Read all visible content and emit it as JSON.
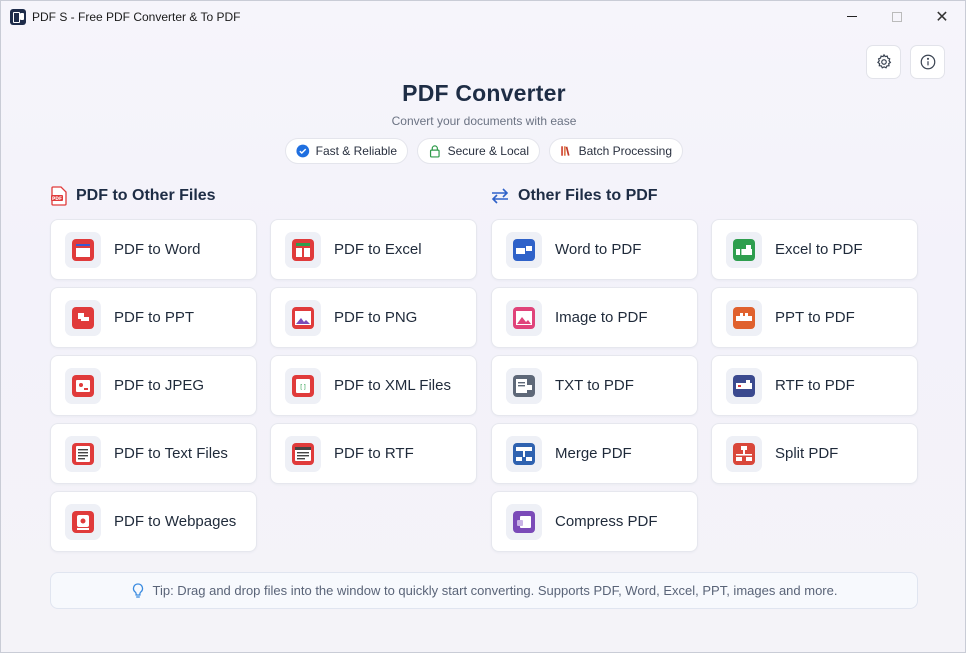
{
  "window": {
    "title": "PDF S - Free PDF Converter & To PDF",
    "minimize": "–",
    "maximize": "□",
    "close": "✕"
  },
  "header": {
    "title": "PDF Converter",
    "subtitle": "Convert your documents with ease",
    "badges": [
      {
        "label": "Fast & Reliable",
        "icon": "check-circle-icon",
        "color": "#1f6fe0"
      },
      {
        "label": "Secure & Local",
        "icon": "lock-icon",
        "color": "#2f9a4a"
      },
      {
        "label": "Batch Processing",
        "icon": "stack-icon",
        "color": "#d04a3a"
      }
    ]
  },
  "toolbar": {
    "settings_icon": "gear-icon",
    "info_icon": "info-icon"
  },
  "sections": {
    "pdf_to_other": {
      "title": "PDF to Other Files",
      "icon": "pdf-file-icon",
      "items": [
        {
          "label": "PDF to Word",
          "icon": "word-doc-icon",
          "color": "#e03b3b"
        },
        {
          "label": "PDF to Excel",
          "icon": "excel-sheet-icon",
          "color": "#e03b3b"
        },
        {
          "label": "PDF to PPT",
          "icon": "slides-icon",
          "color": "#e03b3b"
        },
        {
          "label": "PDF to PNG",
          "icon": "image-icon",
          "color": "#e03b3b"
        },
        {
          "label": "PDF to JPEG",
          "icon": "photo-icon",
          "color": "#e03b3b"
        },
        {
          "label": "PDF to XML Files",
          "icon": "xml-file-icon",
          "color": "#e03b3b"
        },
        {
          "label": "PDF to Text Files",
          "icon": "text-file-icon",
          "color": "#e03b3b"
        },
        {
          "label": "PDF to RTF",
          "icon": "rtf-file-icon",
          "color": "#e03b3b"
        },
        {
          "label": "PDF to Webpages",
          "icon": "webpage-icon",
          "color": "#e03b3b"
        }
      ]
    },
    "other_to_pdf": {
      "title": "Other Files to PDF",
      "icon": "swap-arrows-icon",
      "items": [
        {
          "label": "Word to PDF",
          "icon": "word-to-pdf-icon",
          "color": "#2f62c9"
        },
        {
          "label": "Excel to PDF",
          "icon": "excel-to-pdf-icon",
          "color": "#2e9e4e"
        },
        {
          "label": "Image to PDF",
          "icon": "image-to-pdf-icon",
          "color": "#e0437a"
        },
        {
          "label": "PPT to PDF",
          "icon": "ppt-to-pdf-icon",
          "color": "#e0612e"
        },
        {
          "label": "TXT to PDF",
          "icon": "txt-to-pdf-icon",
          "color": "#5e6878"
        },
        {
          "label": "RTF to PDF",
          "icon": "rtf-to-pdf-icon",
          "color": "#3b4a8f"
        },
        {
          "label": "Merge PDF",
          "icon": "merge-icon",
          "color": "#2f62b0"
        },
        {
          "label": "Split PDF",
          "icon": "split-icon",
          "color": "#d9473a"
        },
        {
          "label": "Compress PDF",
          "icon": "compress-icon",
          "color": "#7b4bb8"
        }
      ]
    }
  },
  "tip": {
    "icon": "lightbulb-icon",
    "text": "Tip: Drag and drop files into the window to quickly start converting. Supports PDF, Word, Excel, PPT, images and more."
  }
}
